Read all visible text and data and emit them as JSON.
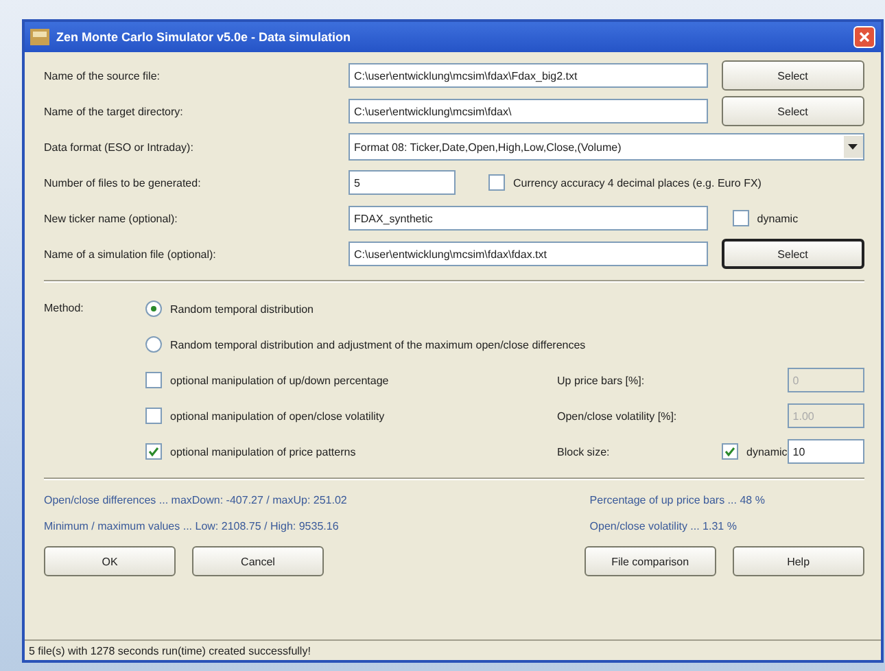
{
  "window": {
    "title": "Zen Monte Carlo Simulator v5.0e - Data simulation"
  },
  "fields": [
    {
      "kind": "file",
      "label": "Name of the source file:",
      "value": "C:\\user\\entwicklung\\mcsim\\fdax\\Fdax_big2.txt",
      "button": "Select",
      "focused": false
    },
    {
      "kind": "file",
      "label": "Name of the target directory:",
      "value": "C:\\user\\entwicklung\\mcsim\\fdax\\",
      "button": "Select",
      "focused": false
    },
    {
      "kind": "select",
      "label": "Data format (ESO or Intraday):",
      "value": "Format 08: Ticker,Date,Open,High,Low,Close,(Volume)"
    },
    {
      "kind": "short",
      "label": "Number of files to be generated:",
      "value": "5",
      "check_label": "Currency accuracy 4 decimal places (e.g. Euro FX)",
      "checked": false
    },
    {
      "kind": "check",
      "label": "New ticker name (optional):",
      "value": "FDAX_synthetic",
      "check_label": "dynamic",
      "checked": false
    },
    {
      "kind": "file",
      "label": "Name of a simulation file (optional):",
      "value": "C:\\user\\entwicklung\\mcsim\\fdax\\fdax.txt",
      "button": "Select",
      "focused": true
    }
  ],
  "method": {
    "label": "Method:",
    "radios": [
      {
        "label": "Random temporal distribution",
        "selected": true
      },
      {
        "label": "Random temporal distribution and adjustment of the maximum open/close differences",
        "selected": false
      }
    ],
    "options": [
      {
        "label": "optional manipulation of up/down percentage",
        "checked": false,
        "param_label": "Up price bars [%]:",
        "value": "0",
        "disabled": true
      },
      {
        "label": "optional manipulation of open/close volatility",
        "checked": false,
        "param_label": "Open/close volatility [%]:",
        "value": "1.00",
        "disabled": true
      },
      {
        "label": "optional manipulation of price patterns",
        "checked": true,
        "param_label": "Block size:",
        "dynamic_label": "dynamic",
        "dynamic_checked": true,
        "value": "10",
        "disabled": false
      }
    ]
  },
  "stats_left": [
    "Open/close differences ... maxDown: -407.27 / maxUp: 251.02",
    "Minimum / maximum values ... Low: 2108.75 / High: 9535.16"
  ],
  "stats_right": [
    "Percentage of up price bars ... 48 %",
    "Open/close volatility ... 1.31 %"
  ],
  "buttons_left": [
    "OK",
    "Cancel"
  ],
  "buttons_right": [
    "File comparison",
    "Help"
  ],
  "status_bar": "5 file(s) with 1278 seconds run(time) created successfully!"
}
